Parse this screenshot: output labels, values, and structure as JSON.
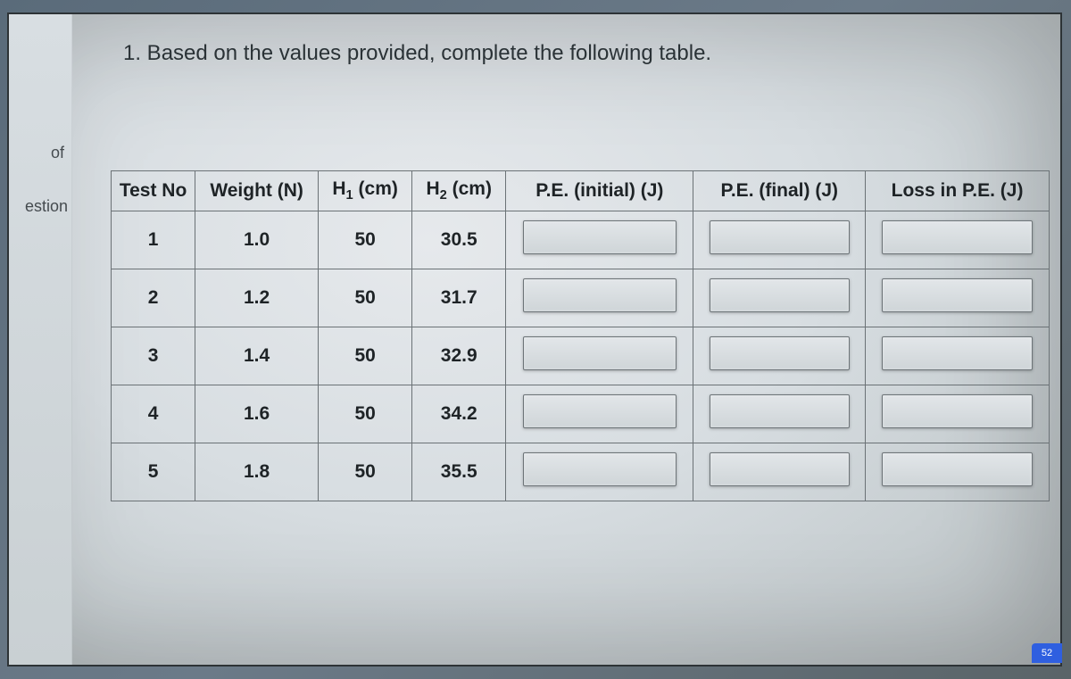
{
  "side": {
    "of_fragment": "of",
    "estion_fragment": "estion"
  },
  "prompt": "1. Based on the values provided, complete the following table.",
  "table": {
    "headers": {
      "test_no": "Test No",
      "weight": "Weight (N)",
      "h1_pre": "H",
      "h1_sub": "1",
      "h1_post": " (cm)",
      "h2_pre": "H",
      "h2_sub": "2",
      "h2_post": " (cm)",
      "pe_initial": "P.E. (initial) (J)",
      "pe_final": "P.E. (final) (J)",
      "loss": "Loss in P.E. (J)"
    },
    "rows": [
      {
        "test_no": "1",
        "weight": "1.0",
        "h1": "50",
        "h2": "30.5"
      },
      {
        "test_no": "2",
        "weight": "1.2",
        "h1": "50",
        "h2": "31.7"
      },
      {
        "test_no": "3",
        "weight": "1.4",
        "h1": "50",
        "h2": "32.9"
      },
      {
        "test_no": "4",
        "weight": "1.6",
        "h1": "50",
        "h2": "34.2"
      },
      {
        "test_no": "5",
        "weight": "1.8",
        "h1": "50",
        "h2": "35.5"
      }
    ]
  },
  "badge": "52"
}
